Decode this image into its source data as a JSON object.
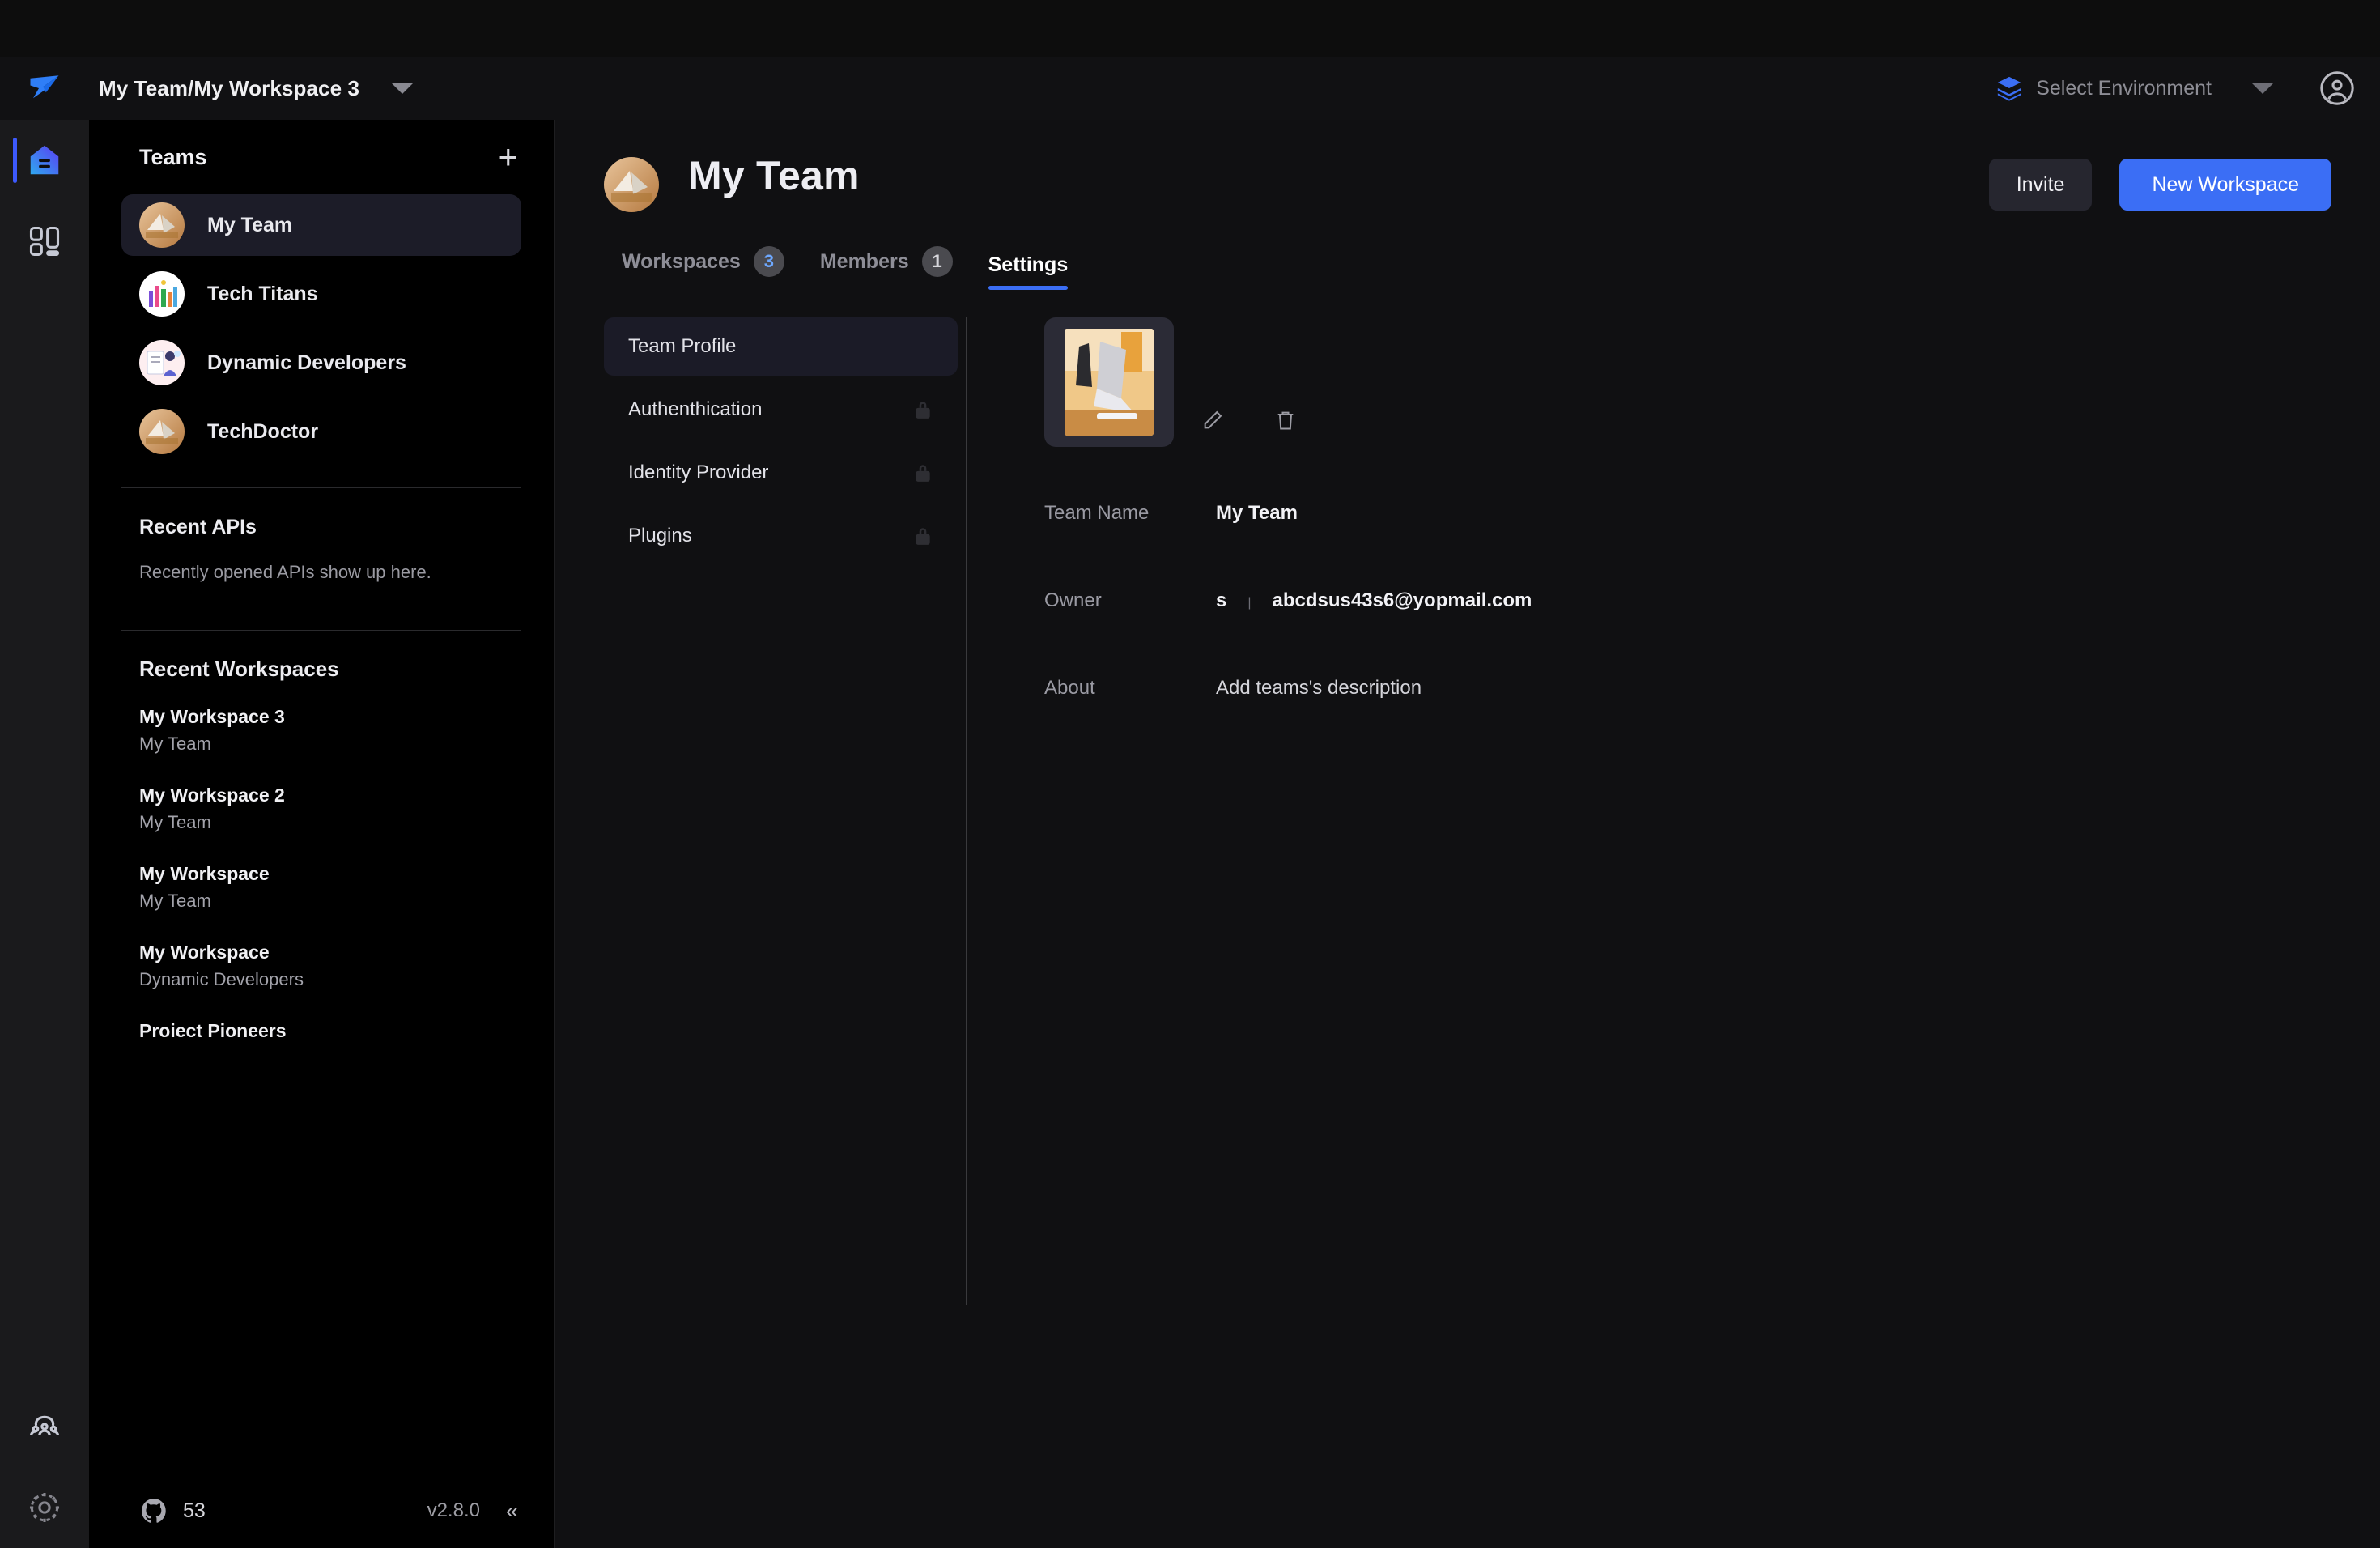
{
  "topbar": {
    "logo_icon": "hoppscotch-bird-logo",
    "breadcrumb": "My Team/My Workspace 3",
    "breadcrumb_caret_icon": "chevron-down-icon",
    "environment": {
      "icon": "layers-icon",
      "label": "Select Environment",
      "caret_icon": "chevron-down-icon"
    },
    "account_icon": "user-circle-icon"
  },
  "rail": {
    "items": [
      {
        "name": "home",
        "icon": "home-icon",
        "active": true
      },
      {
        "name": "spaces",
        "icon": "grid-layout-icon",
        "active": false
      },
      {
        "name": "teams",
        "icon": "people-icon",
        "active": false
      },
      {
        "name": "settings",
        "icon": "gear-icon",
        "active": false
      }
    ]
  },
  "sidebar": {
    "teams_title": "Teams",
    "add_team_icon": "plus-icon",
    "teams": [
      {
        "name": "My Team",
        "avatar": "desk-laptop-photo",
        "active": true
      },
      {
        "name": "Tech Titans",
        "avatar": "city-skyline-illustration",
        "active": false
      },
      {
        "name": "Dynamic Developers",
        "avatar": "person-checklist-illustration",
        "active": false
      },
      {
        "name": "TechDoctor",
        "avatar": "desk-laptop-photo",
        "active": false
      }
    ],
    "recent_apis": {
      "title": "Recent APIs",
      "empty_text": "Recently opened APIs show up here."
    },
    "recent_workspaces": {
      "title": "Recent Workspaces",
      "items": [
        {
          "name": "My Workspace 3",
          "team": "My Team"
        },
        {
          "name": "My Workspace 2",
          "team": "My Team"
        },
        {
          "name": "My Workspace",
          "team": "My Team"
        },
        {
          "name": "My Workspace",
          "team": "Dynamic Developers"
        },
        {
          "name": "Proiect Pioneers",
          "team": ""
        }
      ],
      "scroll_up_icon": "triangle-up-icon",
      "scroll_down_icon": "triangle-down-icon"
    },
    "footer": {
      "github_icon": "github-icon",
      "github_count": "53",
      "version": "v2.8.0",
      "collapse_icon": "chevron-double-left-icon",
      "collapse_label": "«"
    }
  },
  "main": {
    "team_avatar": "desk-laptop-photo",
    "team_title": "My Team",
    "invite_label": "Invite",
    "new_workspace_label": "New Workspace",
    "tabs": [
      {
        "label": "Workspaces",
        "badge": "3",
        "badge_style": "blue",
        "active": false
      },
      {
        "label": "Members",
        "badge": "1",
        "badge_style": "gray",
        "active": false
      },
      {
        "label": "Settings",
        "badge": "",
        "badge_style": "",
        "active": true
      }
    ],
    "settings_nav": [
      {
        "label": "Team Profile",
        "locked": false,
        "active": true
      },
      {
        "label": "Authenthication",
        "locked": true,
        "active": false
      },
      {
        "label": "Identity Provider",
        "locked": true,
        "active": false
      },
      {
        "label": "Plugins",
        "locked": true,
        "active": false
      }
    ],
    "profile": {
      "image_alt": "desk-laptop-photo",
      "edit_icon": "pencil-icon",
      "delete_icon": "trash-icon",
      "fields": [
        {
          "label": "Team Name",
          "value": "My Team",
          "kind": "text"
        },
        {
          "label": "Owner",
          "value": "abcdsus43s6@yopmail.com",
          "owner_name": "s",
          "separator": "|",
          "kind": "owner"
        },
        {
          "label": "About",
          "value": "Add teams's description",
          "kind": "muted"
        }
      ]
    }
  },
  "colors": {
    "accent_blue": "#3b6ef5",
    "rail_active": "#3d5afe",
    "badge_blue_text": "#6ea8ff",
    "panel_bg": "#101012",
    "sidebar_bg": "#000000",
    "topbar_bg": "#111113"
  }
}
